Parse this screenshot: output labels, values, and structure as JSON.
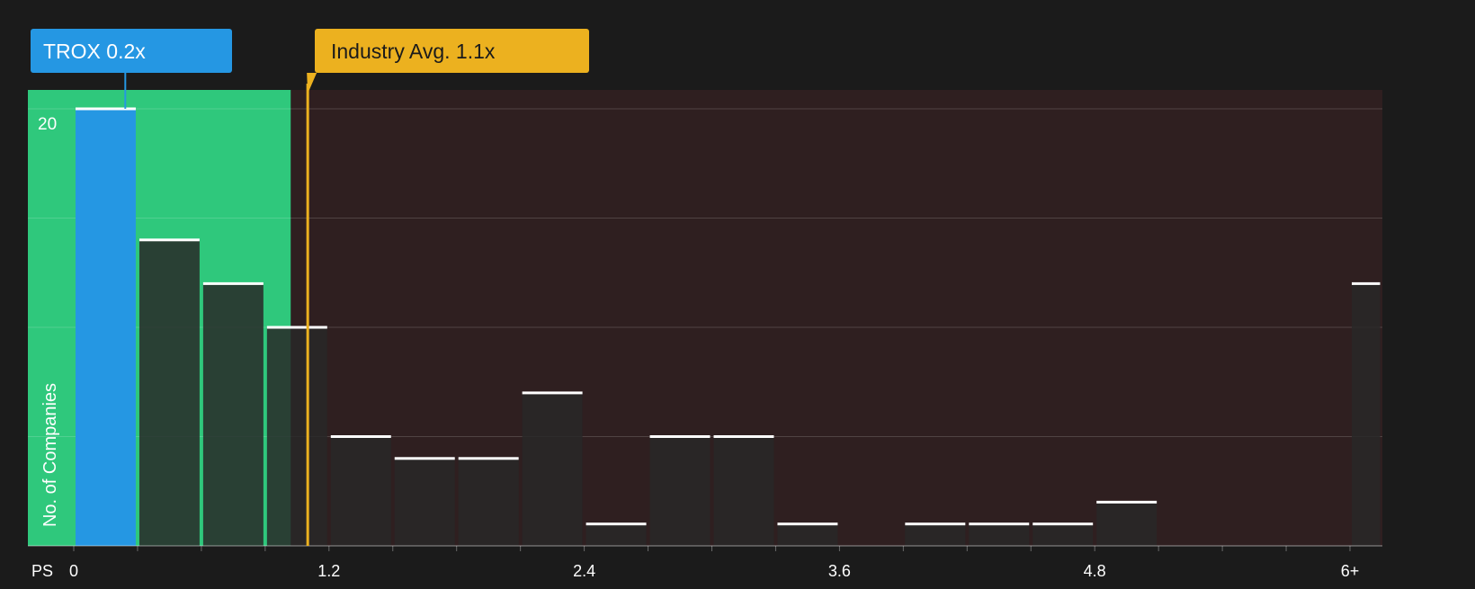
{
  "colors": {
    "background": "#1b1b1b",
    "undervalued_zone": "#2fc87c",
    "overvalued_zone": "#2f1f20",
    "company_bar": "#2597e3",
    "industry_marker": "#ecb11f",
    "bar_cap": "#ffffff",
    "bar_fill_dark": "rgba(40,40,40,0.85)"
  },
  "company_callout": {
    "label": "TROX 0.2x"
  },
  "industry_callout": {
    "label": "Industry Avg. 1.1x"
  },
  "chart_data": {
    "type": "bar",
    "x_axis_label": "PS",
    "y_axis_label": "No. of Companies",
    "y_tick_labels": [
      "20"
    ],
    "x_tick_labels": [
      "0",
      "1.2",
      "2.4",
      "3.6",
      "4.8",
      "6+"
    ],
    "x_ticks": [
      0,
      1.2,
      2.4,
      3.6,
      4.8,
      6
    ],
    "ylim": [
      0,
      20
    ],
    "xlim": [
      0,
      6.15
    ],
    "gridlines_y": [
      5,
      10,
      15,
      20
    ],
    "bin_width": 0.3,
    "bins": [
      {
        "start": 0.0,
        "end": 0.3,
        "count": 20
      },
      {
        "start": 0.3,
        "end": 0.6,
        "count": 14
      },
      {
        "start": 0.6,
        "end": 0.9,
        "count": 12
      },
      {
        "start": 0.9,
        "end": 1.2,
        "count": 10
      },
      {
        "start": 1.2,
        "end": 1.5,
        "count": 5
      },
      {
        "start": 1.5,
        "end": 1.8,
        "count": 4
      },
      {
        "start": 1.8,
        "end": 2.1,
        "count": 4
      },
      {
        "start": 2.1,
        "end": 2.4,
        "count": 7
      },
      {
        "start": 2.4,
        "end": 2.7,
        "count": 1
      },
      {
        "start": 2.7,
        "end": 3.0,
        "count": 5
      },
      {
        "start": 3.0,
        "end": 3.3,
        "count": 5
      },
      {
        "start": 3.3,
        "end": 3.6,
        "count": 1
      },
      {
        "start": 3.9,
        "end": 4.2,
        "count": 1
      },
      {
        "start": 4.2,
        "end": 4.5,
        "count": 1
      },
      {
        "start": 4.5,
        "end": 4.8,
        "count": 1
      },
      {
        "start": 4.8,
        "end": 5.1,
        "count": 2
      },
      {
        "start": 6.0,
        "end": 6.15,
        "count": 12
      }
    ],
    "company_value": 0.2,
    "industry_avg": 1.1,
    "undervalued_zone_end": 1.02
  }
}
